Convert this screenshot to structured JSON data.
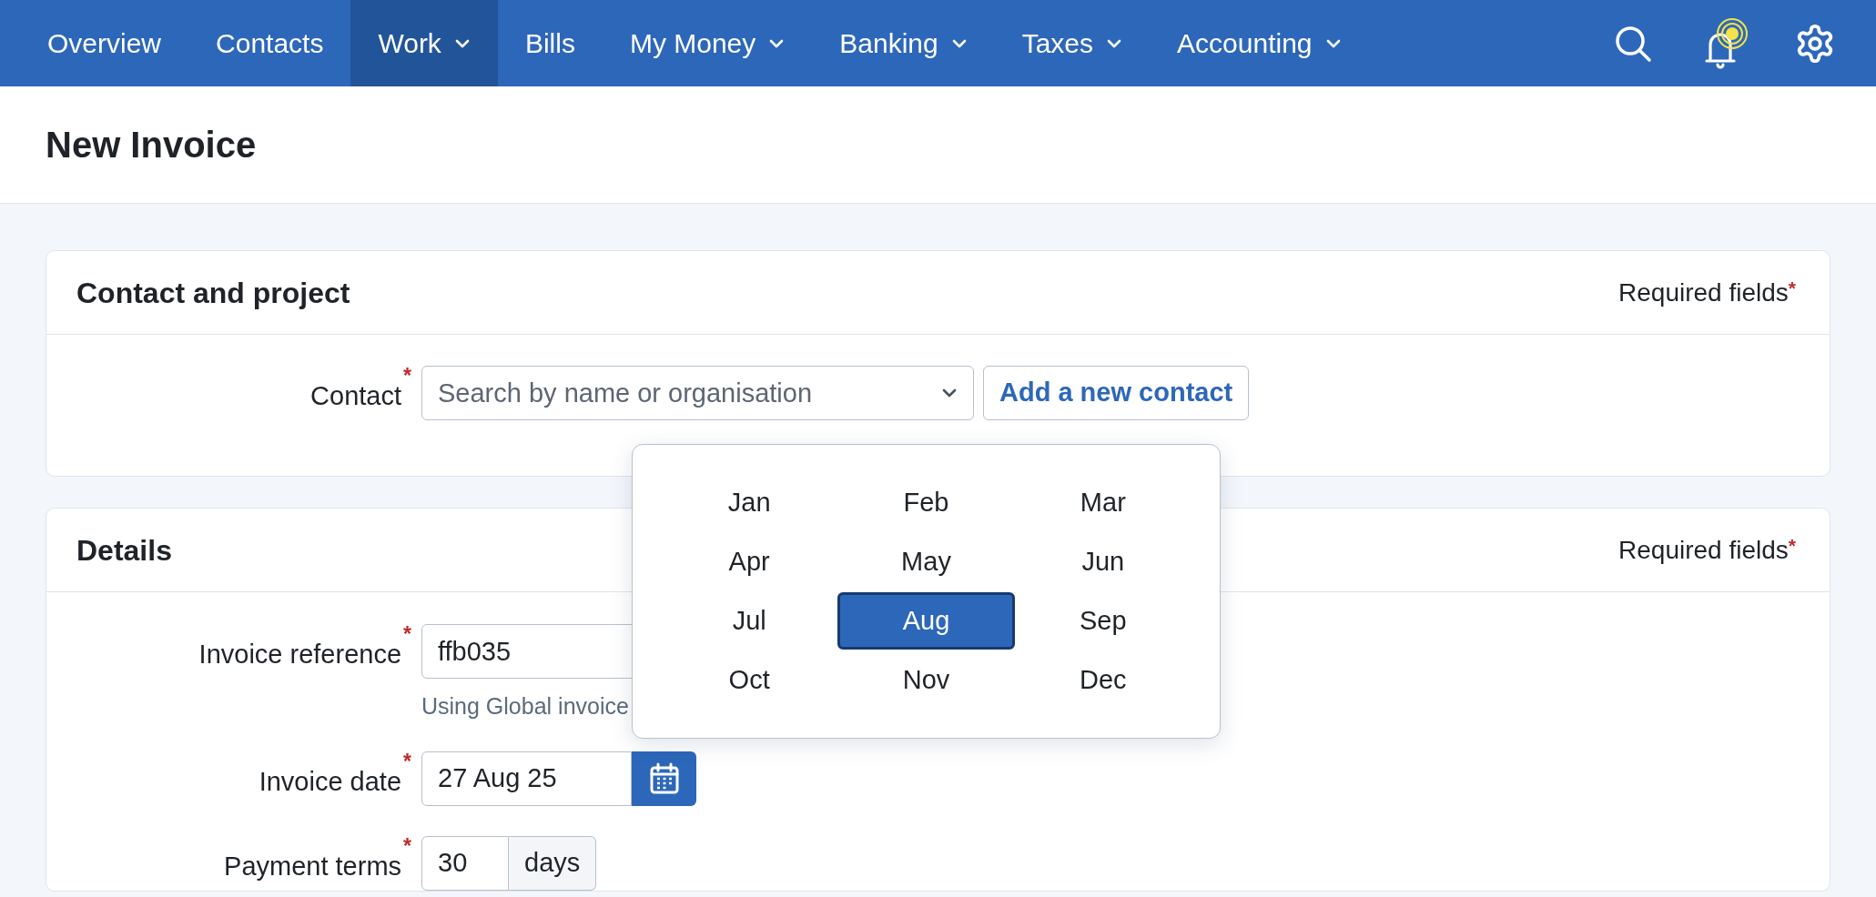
{
  "nav": {
    "items": [
      {
        "label": "Overview",
        "dropdown": false,
        "selected": false
      },
      {
        "label": "Contacts",
        "dropdown": false,
        "selected": false
      },
      {
        "label": "Work",
        "dropdown": true,
        "selected": true
      },
      {
        "label": "Bills",
        "dropdown": false,
        "selected": false
      },
      {
        "label": "My Money",
        "dropdown": true,
        "selected": false
      },
      {
        "label": "Banking",
        "dropdown": true,
        "selected": false
      },
      {
        "label": "Taxes",
        "dropdown": true,
        "selected": false
      },
      {
        "label": "Accounting",
        "dropdown": true,
        "selected": false
      }
    ],
    "notification_unread": true
  },
  "page_title": "New Invoice",
  "contact_section": {
    "title": "Contact and project",
    "required_note": "Required fields",
    "required_mark": "*",
    "contact": {
      "label": "Contact",
      "required_mark": "*",
      "placeholder": "Search by name or organisation"
    },
    "add_button": "Add a new contact"
  },
  "details_section": {
    "title": "Details",
    "required_note": "Required fields",
    "required_mark": "*",
    "invoice_reference": {
      "label": "Invoice reference",
      "required_mark": "*",
      "value": "ffb035",
      "hint": "Using Global invoice"
    },
    "invoice_date": {
      "label": "Invoice date",
      "required_mark": "*",
      "value": "27 Aug 25"
    },
    "payment_terms": {
      "label": "Payment terms",
      "required_mark": "*",
      "value": "30",
      "unit": "days"
    }
  },
  "month_picker": {
    "months": [
      {
        "label": "Jan",
        "selected": false
      },
      {
        "label": "Feb",
        "selected": false
      },
      {
        "label": "Mar",
        "selected": false
      },
      {
        "label": "Apr",
        "selected": false
      },
      {
        "label": "May",
        "selected": false
      },
      {
        "label": "Jun",
        "selected": false
      },
      {
        "label": "Jul",
        "selected": false
      },
      {
        "label": "Aug",
        "selected": true
      },
      {
        "label": "Sep",
        "selected": false
      },
      {
        "label": "Oct",
        "selected": false
      },
      {
        "label": "Nov",
        "selected": false
      },
      {
        "label": "Dec",
        "selected": false
      }
    ]
  }
}
